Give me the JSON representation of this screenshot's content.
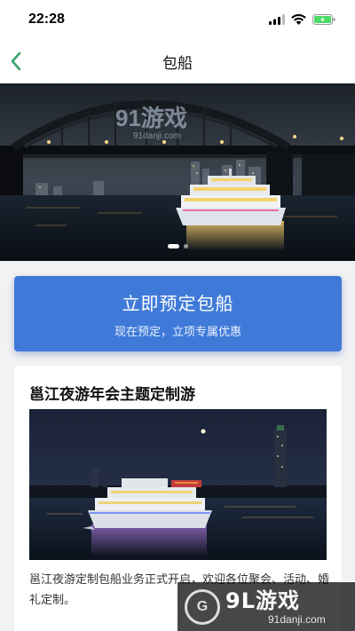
{
  "status_bar": {
    "time": "22:28",
    "icons": [
      "signal-icon",
      "wifi-icon",
      "battery-charging-icon"
    ]
  },
  "nav": {
    "title": "包船",
    "back_icon": "chevron-left-icon"
  },
  "banner": {
    "slide_count": 2,
    "active_slide": 1,
    "overlay_logo": "91游戏",
    "overlay_url": "91danji.com"
  },
  "booking": {
    "title": "立即预定包船",
    "subtitle": "现在预定，立项专属优惠"
  },
  "card": {
    "title": "邕江夜游年会主题定制游",
    "description": "邕江夜游定制包船业务正式开启，欢迎各位聚会、活动、婚礼定制。"
  },
  "watermark": {
    "brand": "9L游戏",
    "url": "91danji.com"
  },
  "colors": {
    "accent_green": "#3aa36b",
    "button_blue": "#3f7ad8",
    "page_bg": "#f2f2f4"
  }
}
